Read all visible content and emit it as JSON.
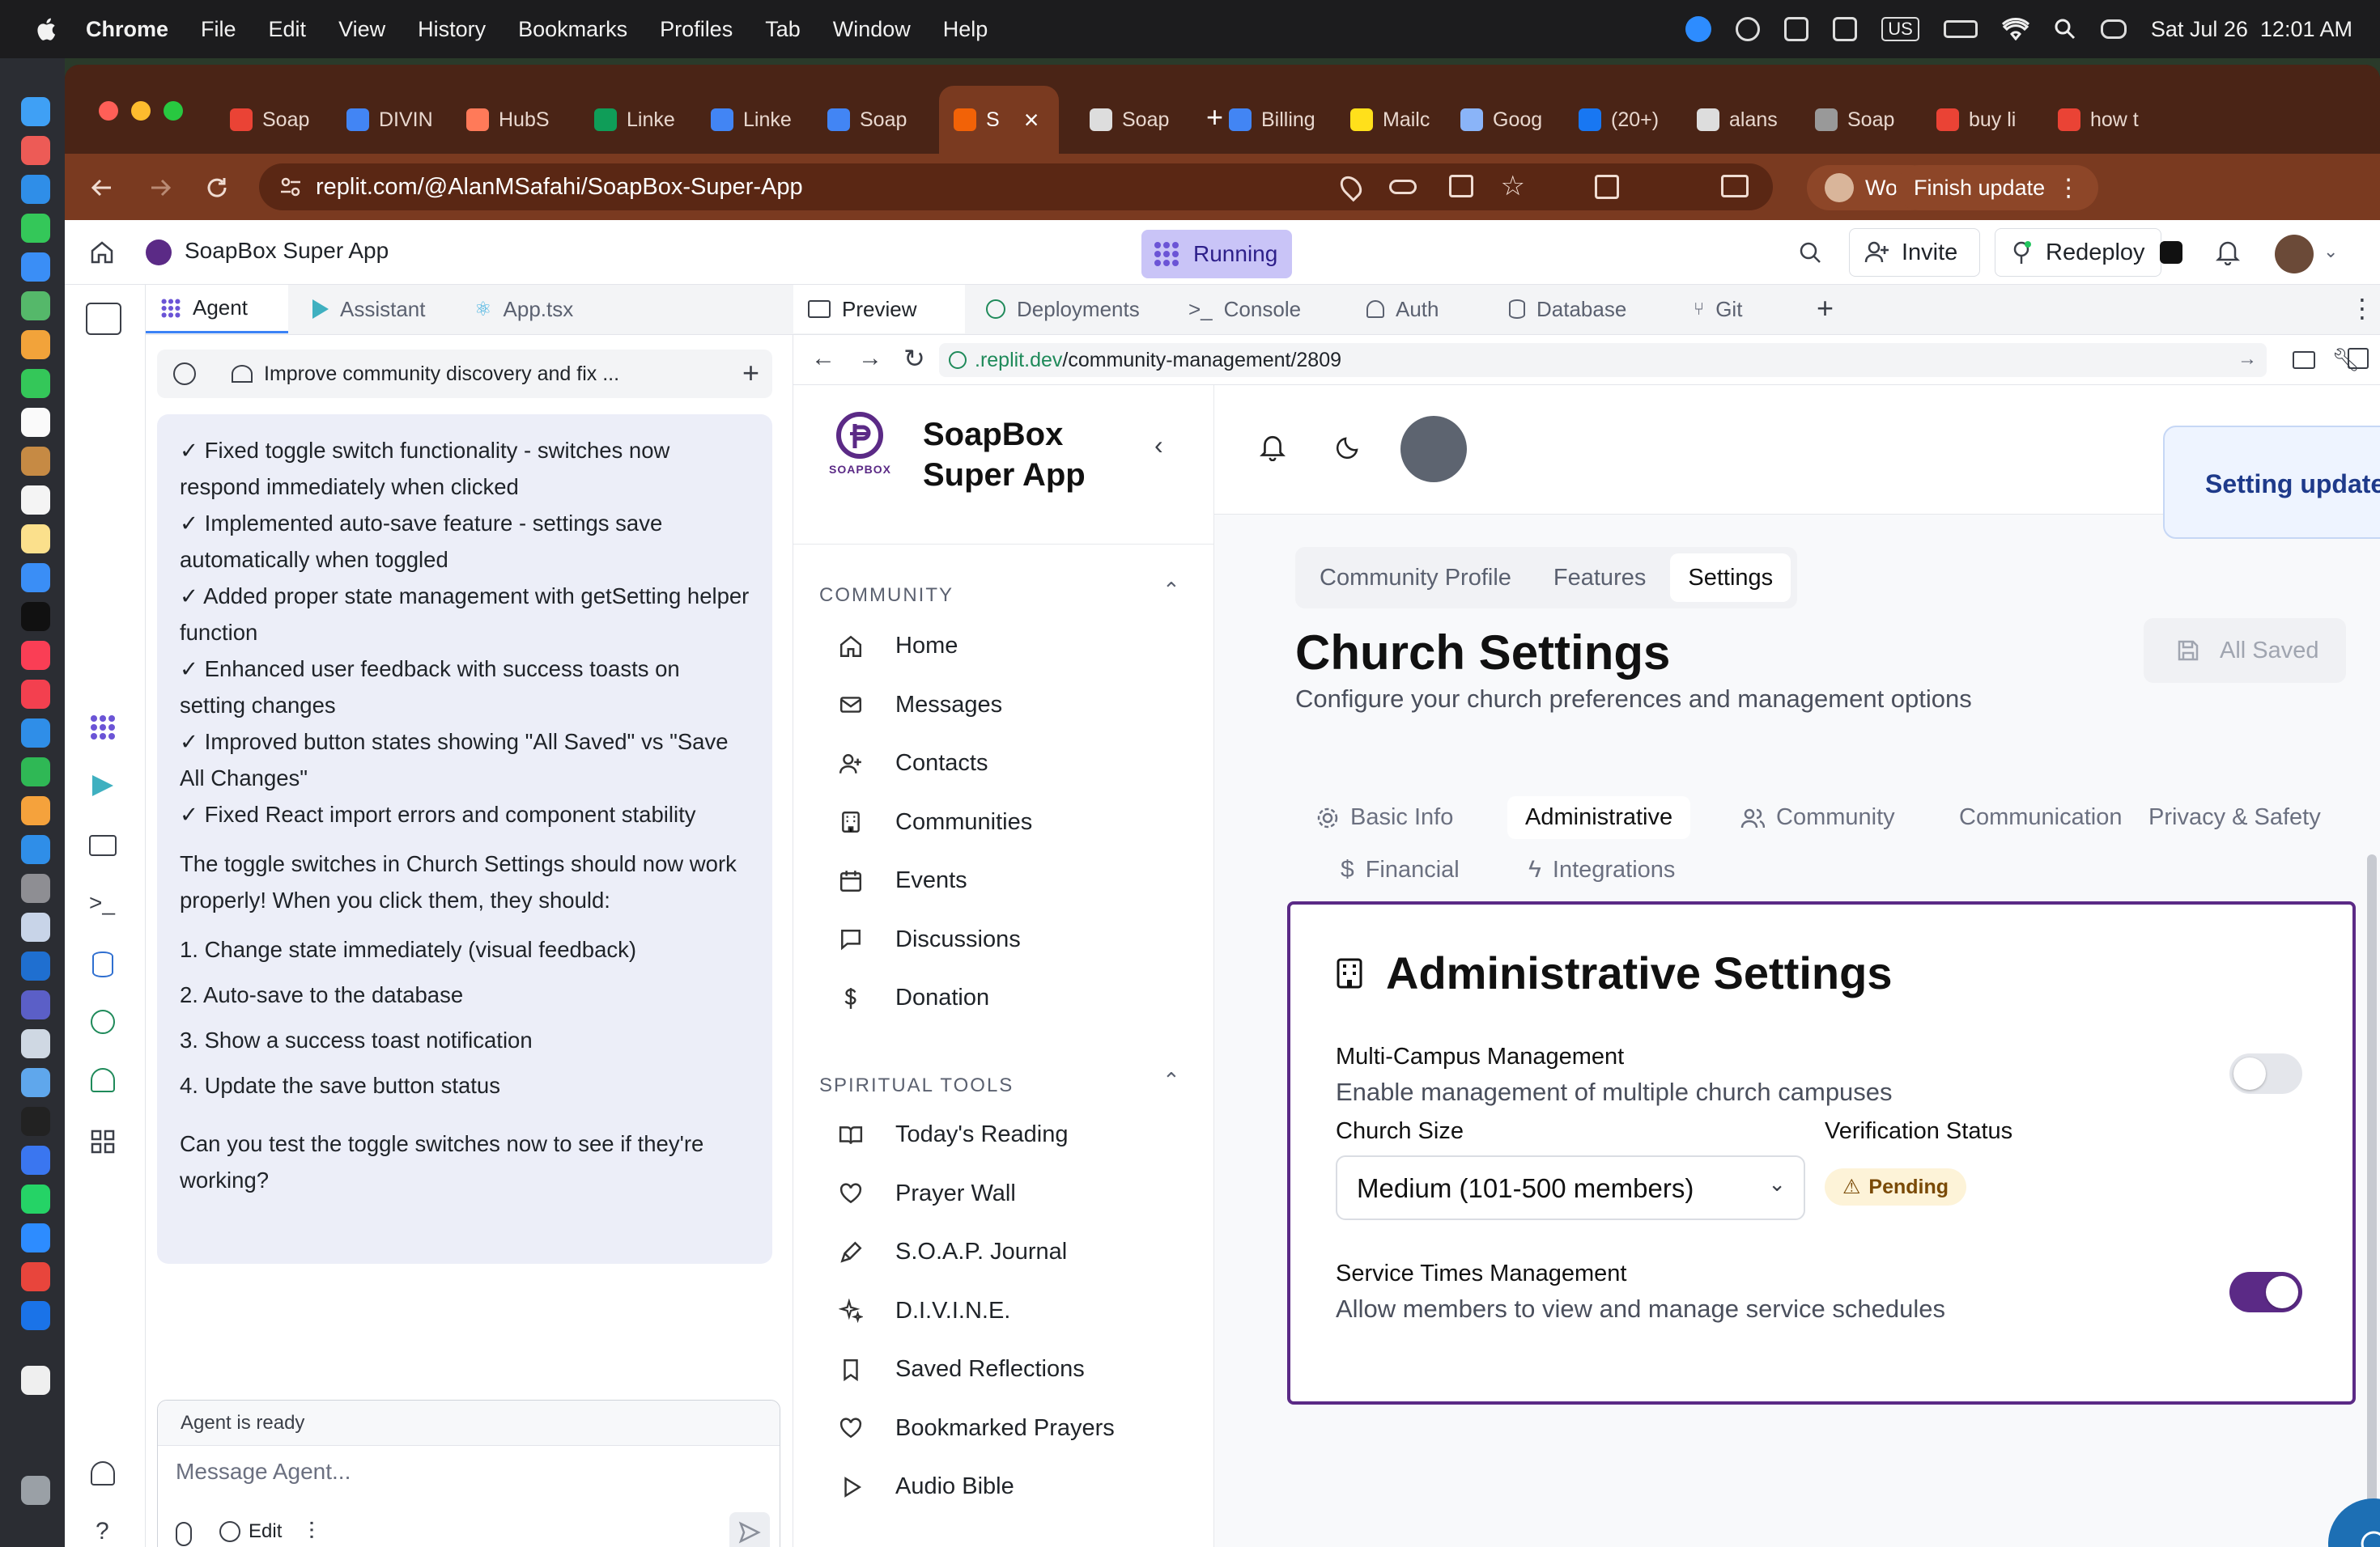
{
  "menubar": {
    "app": "Chrome",
    "items": [
      "File",
      "Edit",
      "View",
      "History",
      "Bookmarks",
      "Profiles",
      "Tab",
      "Window",
      "Help"
    ],
    "input_source": "US",
    "clock": "Sat Jul 26  12:01 AM"
  },
  "browser": {
    "tabs": [
      {
        "label": "Soap",
        "color": "#ea4335"
      },
      {
        "label": "DIVIN",
        "color": "#4285f4"
      },
      {
        "label": "HubS",
        "color": "#ff7a59"
      },
      {
        "label": "Linke",
        "color": "#0f9d58"
      },
      {
        "label": "Linke",
        "color": "#4285f4"
      },
      {
        "label": "Soap",
        "color": "#4285f4"
      },
      {
        "label": "S",
        "color": "#f26207",
        "active": true
      },
      {
        "label": "Soap",
        "color": "#dddddd"
      },
      {
        "label": "Billing",
        "color": "#4285f4"
      },
      {
        "label": "Mailc",
        "color": "#ffe01b"
      },
      {
        "label": "Goog",
        "color": "#8ab4f8"
      },
      {
        "label": "(20+)",
        "color": "#1877f2"
      },
      {
        "label": "alans",
        "color": "#dddddd"
      },
      {
        "label": "Soap",
        "color": "#999999"
      },
      {
        "label": "buy li",
        "color": "#ea4335"
      },
      {
        "label": "how t",
        "color": "#ea4335"
      }
    ],
    "url": "replit.com/@AlanMSafahi/SoapBox-Super-App",
    "profile": "Work",
    "finish_update": "Finish update"
  },
  "replit": {
    "project_name": "SoapBox Super App",
    "status": "Running",
    "invite": "Invite",
    "redeploy": "Redeploy",
    "agent_tabs": [
      "Agent",
      "Assistant",
      "App.tsx"
    ],
    "thread_title": "Improve community discovery and fix ...",
    "agent_message": {
      "checklist": [
        "✓ Fixed toggle switch functionality - switches now respond immediately when clicked",
        "✓ Implemented auto-save feature - settings save automatically when toggled",
        "✓ Added proper state management with getSetting helper function",
        "✓ Enhanced user feedback with success toasts on setting changes",
        "✓ Improved button states showing \"All Saved\" vs \"Save All Changes\"",
        "✓ Fixed React import errors and component stability"
      ],
      "intro": "The toggle switches in Church Settings should now work properly! When you click them, they should:",
      "steps": [
        "1. Change state immediately (visual feedback)",
        "2. Auto-save to the database",
        "3. Show a success toast notification",
        "4. Update the save button status"
      ],
      "question": "Can you test the toggle switches now to see if they're working?"
    },
    "agent_status": "Agent is ready",
    "message_placeholder": "Message Agent...",
    "edit_label": "Edit",
    "preview_tabs": [
      "Preview",
      "Deployments",
      "Console",
      "Auth",
      "Database",
      "Git"
    ],
    "preview_url_domain": ".replit.dev",
    "preview_url_path": "/community-management/2809"
  },
  "app": {
    "brand_line1": "SoapBox",
    "brand_line2": "Super App",
    "logo_text": "SOAPBOX",
    "community_header": "COMMUNITY",
    "community_nav": [
      {
        "label": "Home",
        "icon": "home-icon"
      },
      {
        "label": "Messages",
        "icon": "mail-icon"
      },
      {
        "label": "Contacts",
        "icon": "user-plus-icon"
      },
      {
        "label": "Communities",
        "icon": "building-icon"
      },
      {
        "label": "Events",
        "icon": "calendar-icon"
      },
      {
        "label": "Discussions",
        "icon": "chat-icon"
      },
      {
        "label": "Donation",
        "icon": "dollar-icon"
      }
    ],
    "spiritual_header": "SPIRITUAL TOOLS",
    "spiritual_nav": [
      {
        "label": "Today's Reading",
        "icon": "book-icon"
      },
      {
        "label": "Prayer Wall",
        "icon": "heart-icon"
      },
      {
        "label": "S.O.A.P. Journal",
        "icon": "pen-icon"
      },
      {
        "label": "D.I.V.I.N.E.",
        "icon": "sparkles-icon"
      },
      {
        "label": "Saved Reflections",
        "icon": "bookmark-icon"
      },
      {
        "label": "Bookmarked Prayers",
        "icon": "heart-icon"
      },
      {
        "label": "Audio Bible",
        "icon": "play-icon"
      }
    ],
    "toast": "Setting updated successfully!",
    "top_tabs": [
      "Community Profile",
      "Features",
      "Settings"
    ],
    "page_title": "Church Settings",
    "page_subtitle": "Configure your church preferences and management options",
    "all_saved": "All Saved",
    "settings_tabs": [
      "Basic Info",
      "Administrative",
      "Community",
      "Communication",
      "Privacy & Safety",
      "Financial",
      "Integrations"
    ],
    "admin": {
      "title": "Administrative Settings",
      "multi_campus_label": "Multi-Campus Management",
      "multi_campus_desc": "Enable management of multiple church campuses",
      "multi_campus_on": false,
      "church_size_label": "Church Size",
      "church_size_value": "Medium (101-500 members)",
      "verification_label": "Verification Status",
      "verification_value": "Pending",
      "service_times_label": "Service Times Management",
      "service_times_desc": "Allow members to view and manage service schedules",
      "service_times_on": true
    }
  },
  "colors": {
    "accent_purple": "#5b2a86",
    "replit_orange": "#f26207",
    "toast_text": "#1e3a8a"
  }
}
